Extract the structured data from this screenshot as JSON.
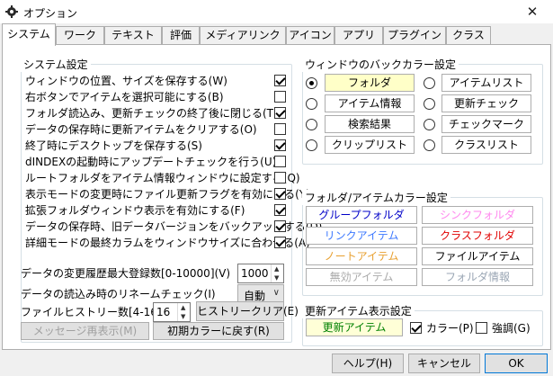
{
  "window": {
    "title": "オプション",
    "close_glyph": "✕"
  },
  "tabs": [
    "システム",
    "ワーク",
    "テキスト",
    "評価",
    "メディアリンク",
    "アイコン",
    "アプリ",
    "プラグイン",
    "クラス"
  ],
  "system_settings": {
    "title": "システム設定",
    "items": [
      {
        "label": "ウィンドウの位置、サイズを保存する(W)",
        "checked": true
      },
      {
        "label": "右ボタンでアイテムを選択可能にする(B)",
        "checked": false
      },
      {
        "label": "フォルダ読込み、更新チェックの終了後に閉じる(T)",
        "checked": true
      },
      {
        "label": "データの保存時に更新アイテムをクリアする(O)",
        "checked": false
      },
      {
        "label": "終了時にデスクトップを保存する(S)",
        "checked": true
      },
      {
        "label": "dINDEXの起動時にアップデートチェックを行う(U)",
        "checked": false
      },
      {
        "label": "ルートフォルダをアイテム情報ウィンドウに設定する(Q)",
        "checked": false
      },
      {
        "label": "表示モードの変更時にファイル更新フラグを有効にする(Y)",
        "checked": true
      },
      {
        "label": "拡張フォルダウィンドウ表示を有効にする(F)",
        "checked": true
      },
      {
        "label": "データの保存時、旧データバージョンをバックアップする(D)",
        "checked": true
      },
      {
        "label": "詳細モードの最終カラムをウィンドウサイズに合わせる(A)",
        "checked": true
      }
    ],
    "history_max_label": "データの変更履歴最大登録数[0-10000](V)",
    "history_max_value": "1000",
    "rename_check_label": "データの読込み時のリネームチェック(I)",
    "rename_check_value": "自動",
    "file_history_label": "ファイルヒストリー数[4-16](N)",
    "file_history_value": "16",
    "history_clear_button": "ヒストリークリア(E)",
    "message_redisplay_button": "メッセージ再表示(M)",
    "reset_colors_button": "初期カラーに戻す(R)"
  },
  "window_back_color": {
    "title": "ウィンドウのバックカラー設定",
    "options": [
      {
        "label": "フォルダ",
        "selected": true,
        "bg": "#ffffc8"
      },
      {
        "label": "アイテムリスト",
        "selected": false,
        "bg": "#ffffff"
      },
      {
        "label": "アイテム情報",
        "selected": false,
        "bg": "#ffffff"
      },
      {
        "label": "更新チェック",
        "selected": false,
        "bg": "#ffffff"
      },
      {
        "label": "検索結果",
        "selected": false,
        "bg": "#ffffff"
      },
      {
        "label": "チェックマーク",
        "selected": false,
        "bg": "#ffffff"
      },
      {
        "label": "クリップリスト",
        "selected": false,
        "bg": "#ffffff"
      },
      {
        "label": "クラスリスト",
        "selected": false,
        "bg": "#ffffff"
      }
    ]
  },
  "folder_item_color": {
    "title": "フォルダ/アイテムカラー設定",
    "items": [
      {
        "label": "グループフォルダ",
        "color": "#0000c8"
      },
      {
        "label": "シンクフォルダ",
        "color": "#ff88ee"
      },
      {
        "label": "リンクアイテム",
        "color": "#3c78ff"
      },
      {
        "label": "クラスフォルダ",
        "color": "#e00000"
      },
      {
        "label": "ノートアイテム",
        "color": "#e8a030"
      },
      {
        "label": "ファイルアイテム",
        "color": "#000000"
      },
      {
        "label": "無効アイテム",
        "color": "#aaaaaa"
      },
      {
        "label": "フォルダ情報",
        "color": "#9aa6b4"
      }
    ]
  },
  "updated_item_display": {
    "title": "更新アイテム表示設定",
    "sample_label": "更新アイテム",
    "sample_color": "#008000",
    "sample_bg": "#ffffd7",
    "color_check": {
      "label": "カラー(P)",
      "checked": true
    },
    "bold_check": {
      "label": "強調(G)",
      "checked": false
    }
  },
  "footer": {
    "help": "ヘルプ(H)",
    "cancel": "キャンセル",
    "ok": "OK"
  }
}
